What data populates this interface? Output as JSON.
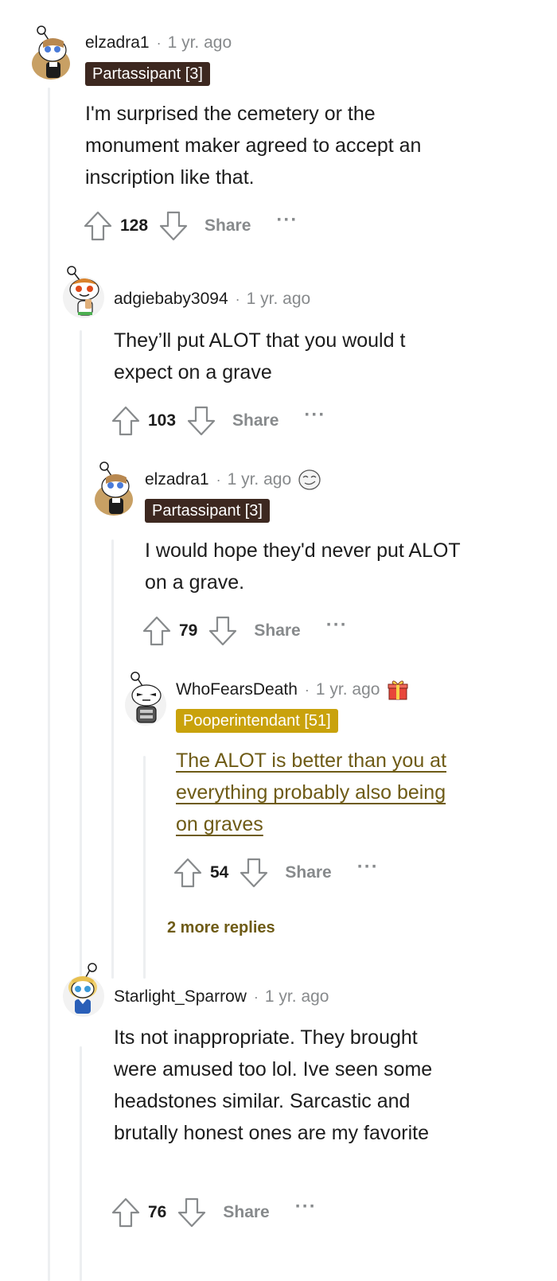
{
  "comments": [
    {
      "username": "elzadra1",
      "separator": "·",
      "timestamp": "1 yr. ago",
      "flair": "Partassipant [3]",
      "body": "I'm surprised the cemetery or the monument maker agreed to accept an inscription like that.",
      "votes": "128",
      "share_label": "Share",
      "more_label": "···"
    },
    {
      "username": "adgiebaby3094",
      "separator": "·",
      "timestamp": "1 yr. ago",
      "body": "They’ll put ALOT that you would t expect on a grave",
      "votes": "103",
      "share_label": "Share",
      "more_label": "···"
    },
    {
      "username": "elzadra1",
      "separator": "·",
      "timestamp": "1 yr. ago",
      "award_icon": "face-award-icon",
      "flair": "Partassipant [3]",
      "body": "I would hope they'd never put ALOT on a grave.",
      "votes": "79",
      "share_label": "Share",
      "more_label": "···"
    },
    {
      "username": "WhoFearsDeath",
      "separator": "·",
      "timestamp": "1 yr. ago",
      "award_icon": "gift-award-icon",
      "flair": "Pooperintendant [51]",
      "body": "The ALOT is better than you at everything probably also being on graves",
      "votes": "54",
      "share_label": "Share",
      "more_label": "···"
    },
    {
      "username": "Starlight_Sparrow",
      "separator": "·",
      "timestamp": "1 yr. ago",
      "body": "Its not inappropriate. They brought were amused too lol. Ive seen some headstones similar. Sarcastic and brutally honest ones are my favorite",
      "votes": "76",
      "share_label": "Share",
      "more_label": "···"
    }
  ],
  "more_replies_label": "2 more replies",
  "colors": {
    "flair_dark": "#3d2820",
    "flair_gold": "#c9a20c",
    "link": "#6e5b16",
    "muted": "#878a8c",
    "thread_line": "#edeff1"
  }
}
